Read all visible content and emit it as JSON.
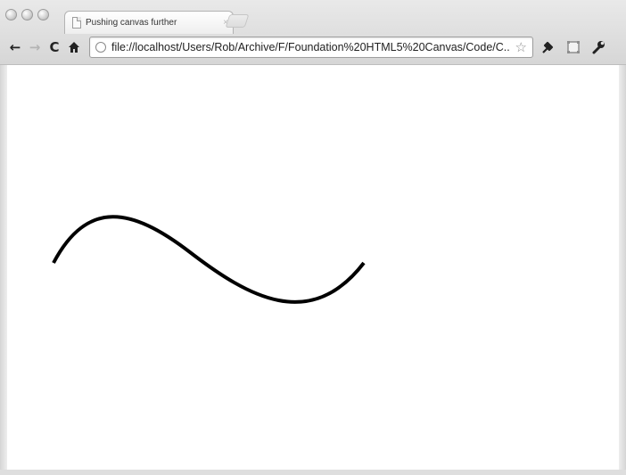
{
  "window": {
    "tab_title": "Pushing canvas further",
    "tab_close": "×"
  },
  "toolbar": {
    "back_label": "←",
    "forward_label": "→",
    "reload_label": "C",
    "url": "file://localhost/Users/Rob/Archive/F/Foundation%20HTML5%20Canvas/Code/C...",
    "star_label": "☆"
  },
  "icons": {
    "back": "back-arrow-icon",
    "forward": "forward-arrow-icon",
    "reload": "reload-icon",
    "home": "home-icon",
    "page": "page-icon",
    "globe": "globe-icon",
    "star": "star-icon",
    "page_menu": "page-menu-icon",
    "window_frame": "window-icon",
    "wrench": "wrench-icon"
  },
  "canvas": {
    "stroke_color": "#000000",
    "background": "#ffffff"
  }
}
